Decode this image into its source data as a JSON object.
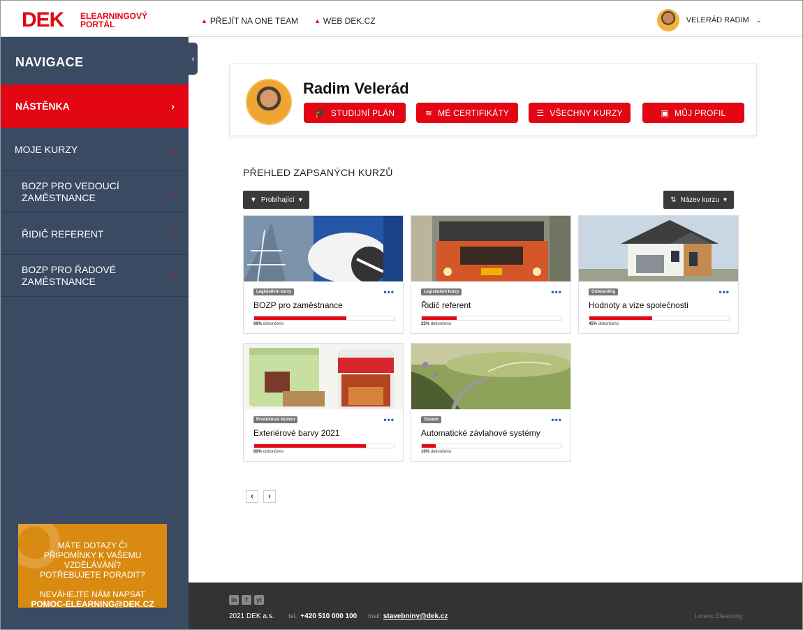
{
  "header": {
    "logo": "DEK",
    "logo_sub": "ELEARNINGOVÝ PORTÁL",
    "links": [
      "PŘEJÍT NA ONE TEAM",
      "WEB DEK.CZ"
    ],
    "user_name": "VELERÁD RADIM"
  },
  "sidebar": {
    "title": "NAVIGACE",
    "active_item": "NÁSTĚNKA",
    "my_courses": "MOJE KURZY",
    "courses": [
      "BOZP PRO VEDOUCÍ ZAMĚSTNANCE",
      "ŘIDIČ REFERENT",
      "BOZP PRO ŘADOVÉ ZAMĚSTNANCE"
    ],
    "help": {
      "line1": "MÁTE DOTAZY ČI PŘIPOMÍNKY K VAŠEMU VZDĚLÁVÁNÍ? POTŘEBUJETE PORADIT?",
      "line2": "NEVÁHEJTE NÁM NAPSAT",
      "email": "POMOC-ELEARNING@DEK.CZ"
    }
  },
  "profile": {
    "name": "Radim Velerád",
    "buttons": [
      "STUDIJNÍ PLÁN",
      "MÉ CERTIFIKÁTY",
      "VŠECHNY KURZY",
      "MŮJ PROFIL"
    ]
  },
  "overview": {
    "title": "PŘEHLED ZAPSANÝCH KURZŮ",
    "filter_label": "Probíhající",
    "sort_label": "Název kurzu"
  },
  "courses": [
    {
      "category": "Legislativní kurzy",
      "title": "BOZP pro zaměstnance",
      "percent": "66%",
      "progress": 0.66
    },
    {
      "category": "Legislativní kurzy",
      "title": "Řidič referent",
      "percent": "25%",
      "progress": 0.25
    },
    {
      "category": "Onboarding",
      "title": "Hodnoty a vize společnosti",
      "percent": "45%",
      "progress": 0.45
    },
    {
      "category": "Produktová školení",
      "title": "Exteriérové barvy 2021",
      "percent": "80%",
      "progress": 0.8
    },
    {
      "category": "Ostatní",
      "title": "Automatické závlahové systémy",
      "percent": "10%",
      "progress": 0.1
    }
  ],
  "progress_suffix": "dokončeno",
  "card_menu": "•••",
  "footer": {
    "social": [
      "in",
      "f",
      "yt"
    ],
    "copyright": "2021 DEK a.s.",
    "tel_label": "tel.:",
    "tel": "+420 510 000 100",
    "mail_label": "mail:",
    "mail": "stavebniny@dek.cz",
    "brand": "Lorenc Elearning"
  }
}
